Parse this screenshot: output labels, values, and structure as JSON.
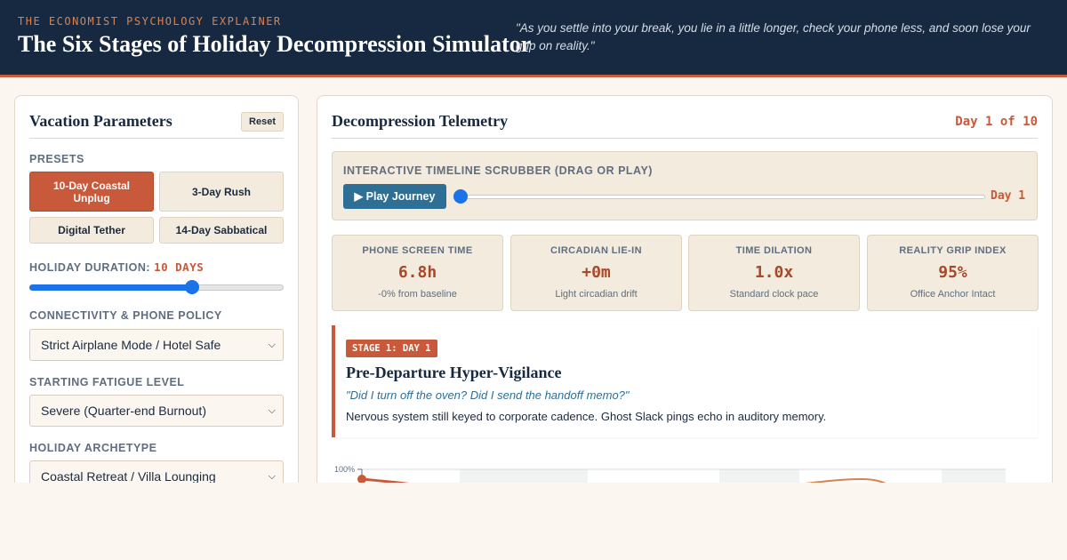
{
  "header": {
    "kicker": "THE ECONOMIST PSYCHOLOGY EXPLAINER",
    "title": "The Six Stages of Holiday Decompression Simulator",
    "quote": "\"As you settle into your break, you lie in a little longer, check your phone less, and soon lose your grip on reality.\""
  },
  "parameters": {
    "title": "Vacation Parameters",
    "reset_label": "Reset",
    "presets_label": "PRESETS",
    "presets": [
      {
        "label": "10-Day Coastal Unplug",
        "active": true
      },
      {
        "label": "3-Day Rush",
        "active": false
      },
      {
        "label": "Digital Tether",
        "active": false
      },
      {
        "label": "14-Day Sabbatical",
        "active": false
      }
    ],
    "duration_label": "HOLIDAY DURATION:",
    "duration_value": "10 DAYS",
    "duration_slider_fraction": 0.64,
    "connectivity_label": "CONNECTIVITY & PHONE POLICY",
    "connectivity_value": "Strict Airplane Mode / Hotel Safe",
    "fatigue_label": "STARTING FATIGUE LEVEL",
    "fatigue_value": "Severe (Quarter-end Burnout)",
    "archetype_label": "HOLIDAY ARCHETYPE",
    "archetype_value": "Coastal Retreat / Villa Lounging"
  },
  "telemetry": {
    "title": "Decompression Telemetry",
    "day_counter": "Day 1 of 10",
    "scrubber_label": "INTERACTIVE TIMELINE SCRUBBER (DRAG OR PLAY)",
    "play_label": "▶ Play Journey",
    "scrubber_day": "Day 1",
    "scrubber_fraction": 0.0,
    "metrics": [
      {
        "label": "PHONE SCREEN TIME",
        "value": "6.8h",
        "sub": "-0% from baseline"
      },
      {
        "label": "CIRCADIAN LIE-IN",
        "value": "+0m",
        "sub": "Light circadian drift"
      },
      {
        "label": "TIME DILATION",
        "value": "1.0x",
        "sub": "Standard clock pace"
      },
      {
        "label": "REALITY GRIP INDEX",
        "value": "95%",
        "sub": "Office Anchor Intact"
      }
    ],
    "stage": {
      "badge": "STAGE 1: DAY 1",
      "title": "Pre-Departure Hyper-Vigilance",
      "quote": "\"Did I turn off the oven? Did I send the handoff memo?\"",
      "description": "Nervous system still keyed to corporate cadence. Ghost Slack pings echo in auditory memory."
    },
    "chart": {
      "y_tick_label": "100%",
      "accent_color": "#c8593a"
    }
  },
  "colors": {
    "navy": "#172940",
    "accent": "#c8593a",
    "panel_beige": "#f3ebdd",
    "teal": "#2e6f96"
  }
}
